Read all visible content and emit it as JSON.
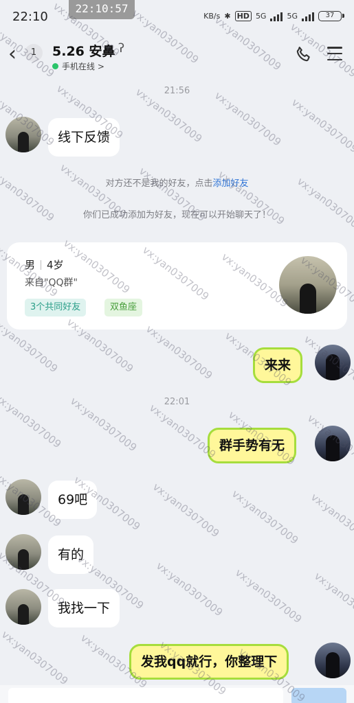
{
  "status_bar": {
    "time": "22:10",
    "recording_time": "22:10:57",
    "network_speed": "KB/s",
    "hd_label": "HD",
    "signal1": "5G",
    "signal2": "5G",
    "battery": "37"
  },
  "header": {
    "unread_count": "1",
    "contact_name": "5.26 安鼻",
    "online_status": "手机在线 >"
  },
  "messages": {
    "time1": "21:56",
    "m1": "线下反馈",
    "sys1_prefix": "对方还不是我的好友，点击",
    "sys1_link": "添加好友",
    "sys2": "你们已成功添加为好友，现在可以开始聊天了！",
    "m2": "来来",
    "time2": "22:01",
    "m3": "群手势有无",
    "m4": "69吧",
    "m5": "有的",
    "m6": "我找一下",
    "m7": "发我qq就行，你整理下"
  },
  "profile_card": {
    "gender": "男",
    "age": "4岁",
    "source": "来自\"QQ群\"",
    "mutual_friends": "3个共同好友",
    "zodiac": "双鱼座"
  },
  "watermark": "vx:yan0307009",
  "colors": {
    "self_bubble": "#fff79a",
    "self_bubble_border": "#a6dd3c",
    "link": "#2f74d6",
    "online": "#2bc46a"
  }
}
